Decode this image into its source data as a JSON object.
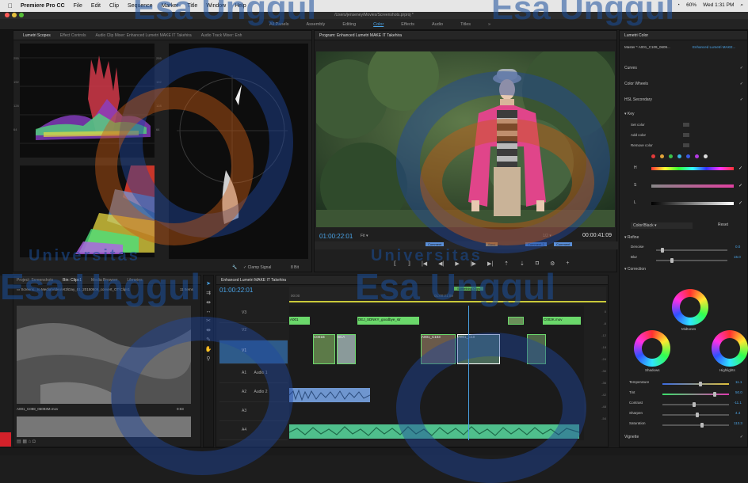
{
  "menubar": {
    "app": "Premiere Pro CC",
    "items": [
      "File",
      "Edit",
      "Clip",
      "Sequence",
      "Marker",
      "Title",
      "Window",
      "Help"
    ],
    "battery": "60%",
    "clock": "Wed 1:31 PM"
  },
  "title_path": "/Users/jenseney/Movies/Screenshots.prproj *",
  "workspaces": [
    "All Panels",
    "Assembly",
    "Editing",
    "Color",
    "Effects",
    "Audio",
    "Titles",
    "»"
  ],
  "scopes": {
    "tabs": [
      "Lumetri Scopes",
      "Effect Controls",
      "Audio Clip Mixer: Enhanced Lumetri MAKE IT Takehira",
      "Audio Track Mixer: Enh"
    ],
    "left_ticks": [
      "255",
      "192",
      "128",
      "64",
      "0"
    ],
    "right_ticks": [
      "255",
      "192",
      "128",
      "64",
      "0"
    ],
    "clamp_label": "Clamp Signal",
    "bit_label": "8 Bit"
  },
  "program": {
    "tab": "Program: Enhanced Lumetri MAKE IT Takehira",
    "timecode": "01:00:22:01",
    "fit": "Fit",
    "page": "1/2",
    "duration": "00:00:41:09",
    "markers": [
      "Comment",
      "Sand",
      "Comment 2",
      "Comment"
    ]
  },
  "project": {
    "tabs": [
      "Project: Screenshots",
      "Bin: Clips1",
      "Media Browser",
      "Libraries"
    ],
    "path": "Screens...ro Media\\Video\\At3\\Day_01_20150609_convert_OT\\Clips1",
    "items_count": "11 Items",
    "clip_name": "A001_C088_06093M.mov",
    "clip_dur": "0:03"
  },
  "timeline": {
    "tab": "Enhanced Lumetri MAKE IT Takehira",
    "timecode": "01:00:22:01",
    "ruler": [
      "00:00",
      "01:00:21:09"
    ],
    "playhead_label": "Something Clips",
    "tracks": [
      "V3",
      "V2",
      "V1",
      "A1",
      "A2",
      "A3",
      "A4"
    ],
    "audio_labels": [
      "Audio 1",
      "Audio 2"
    ],
    "clips": [
      "A001",
      "DEJ_SDNKY_goodbye_str",
      "C001B",
      "BCA",
      "A001_C103",
      "A001_C10",
      "C002K.mov"
    ],
    "meter": [
      "0",
      "-6",
      "-12",
      "-18",
      "-24",
      "-30",
      "-36",
      "-42",
      "-48",
      "-54"
    ]
  },
  "lumetri": {
    "title": "Lumetri Color",
    "master": "Master * A001_C109_0609...",
    "seq": "Enhanced Lumetri MAKE...",
    "sections": [
      "Curves",
      "Color Wheels",
      "HSL Secondary"
    ],
    "key_label": "Key",
    "key_rows": [
      "Set color",
      "Add color",
      "Remove color"
    ],
    "hsl": [
      "H",
      "S",
      "L"
    ],
    "preset": "Color/Black",
    "reset": "Reset",
    "refine": "Refine",
    "denoise": {
      "label": "Denoise",
      "value": "0.0"
    },
    "blur": {
      "label": "Blur",
      "value": "15.0"
    },
    "correction": "Correction",
    "wheels": [
      "Midtones",
      "Shadows",
      "Highlights"
    ],
    "sliders": [
      {
        "label": "Temperature",
        "value": "11.1"
      },
      {
        "label": "Tint",
        "value": "50.0"
      },
      {
        "label": "Contrast",
        "value": "-11.1"
      },
      {
        "label": "Sharpen",
        "value": "4.4"
      },
      {
        "label": "Saturation",
        "value": "113.3"
      }
    ],
    "vignette": "Vignette"
  },
  "watermark": {
    "university": "Universitas",
    "name": "Esa Unggul"
  },
  "colors": {
    "accent": "#4aa3e6",
    "clip_green": "#6bd86b",
    "audio_blue": "#6f96cf"
  }
}
